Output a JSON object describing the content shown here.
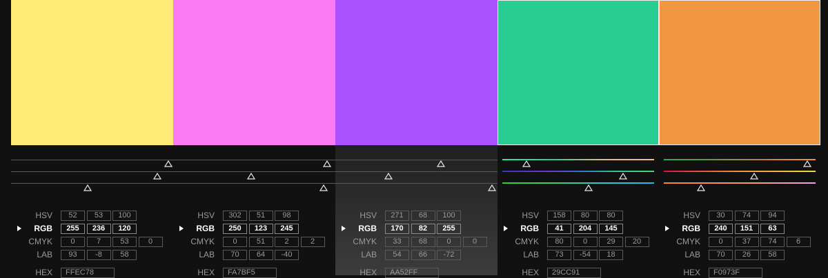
{
  "colors": [
    {
      "swatch": "#FFEC78",
      "hex": "FFEC78",
      "hsv": [
        "52",
        "53",
        "100"
      ],
      "rgb": [
        "255",
        "236",
        "120"
      ],
      "cmyk": [
        "0",
        "7",
        "53",
        "0"
      ],
      "lab": [
        "93",
        "-8",
        "58"
      ]
    },
    {
      "swatch": "#FA7BF5",
      "hex": "FA7BF5",
      "hsv": [
        "302",
        "51",
        "98"
      ],
      "rgb": [
        "250",
        "123",
        "245"
      ],
      "cmyk": [
        "0",
        "51",
        "2",
        "2"
      ],
      "lab": [
        "70",
        "64",
        "-40"
      ]
    },
    {
      "swatch": "#AA52FF",
      "hex": "AA52FF",
      "hsv": [
        "271",
        "68",
        "100"
      ],
      "rgb": [
        "170",
        "82",
        "255"
      ],
      "cmyk": [
        "33",
        "68",
        "0",
        "0"
      ],
      "lab": [
        "54",
        "66",
        "-72"
      ]
    },
    {
      "swatch": "#29CC91",
      "hex": "29CC91",
      "hsv": [
        "158",
        "80",
        "80"
      ],
      "rgb": [
        "41",
        "204",
        "145"
      ],
      "cmyk": [
        "80",
        "0",
        "29",
        "20"
      ],
      "lab": [
        "73",
        "-54",
        "18"
      ]
    },
    {
      "swatch": "#F0973F",
      "hex": "F0973F",
      "hsv": [
        "30",
        "74",
        "94"
      ],
      "rgb": [
        "240",
        "151",
        "63"
      ],
      "cmyk": [
        "0",
        "37",
        "74",
        "6"
      ],
      "lab": [
        "70",
        "26",
        "58"
      ]
    }
  ],
  "labels": {
    "hsv": "HSV",
    "rgb": "RGB",
    "cmyk": "CMYK",
    "lab": "LAB",
    "hex": "HEX"
  },
  "selected_index": 2
}
